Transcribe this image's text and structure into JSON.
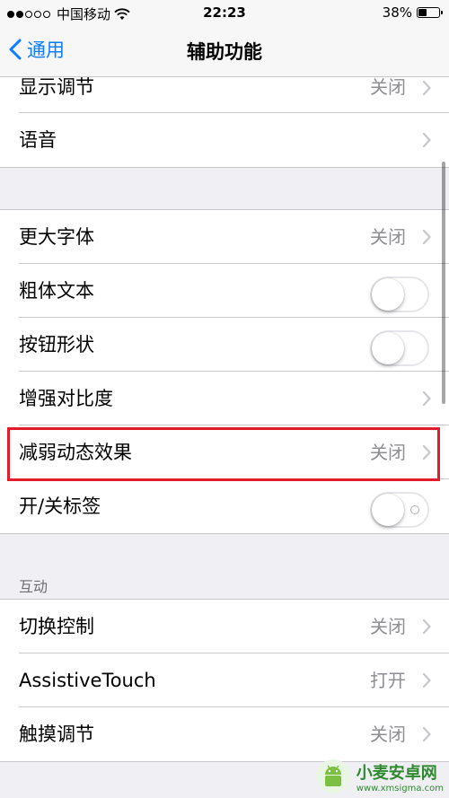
{
  "status": {
    "carrier": "中国移动",
    "time": "22:23",
    "battery": "38%",
    "battery_level": 0.38
  },
  "nav": {
    "back_label": "通用",
    "title": "辅助功能"
  },
  "rows_top": [
    {
      "label": "显示调节",
      "value": "关闭",
      "type": "chevron"
    },
    {
      "label": "语音",
      "value": "",
      "type": "chevron"
    }
  ],
  "rows_display": [
    {
      "label": "更大字体",
      "value": "关闭",
      "type": "chevron"
    },
    {
      "label": "粗体文本",
      "type": "toggle",
      "on": false
    },
    {
      "label": "按钮形状",
      "type": "toggle",
      "on": false
    },
    {
      "label": "增强对比度",
      "value": "",
      "type": "chevron"
    },
    {
      "label": "减弱动态效果",
      "value": "关闭",
      "type": "chevron"
    },
    {
      "label": "开/关标签",
      "type": "toggle",
      "on": false
    }
  ],
  "section_interaction": {
    "header": "互动",
    "rows": [
      {
        "label": "切换控制",
        "value": "关闭",
        "type": "chevron"
      },
      {
        "label": "AssistiveTouch",
        "value": "打开",
        "type": "chevron"
      },
      {
        "label": "触摸调节",
        "value": "关闭",
        "type": "chevron"
      }
    ]
  },
  "watermark": {
    "title": "小麦安卓网",
    "url": "www.xmsigma.com"
  },
  "colors": {
    "accent": "#0a7cff",
    "highlight": "#e21d2b",
    "background": "#efeff4"
  }
}
